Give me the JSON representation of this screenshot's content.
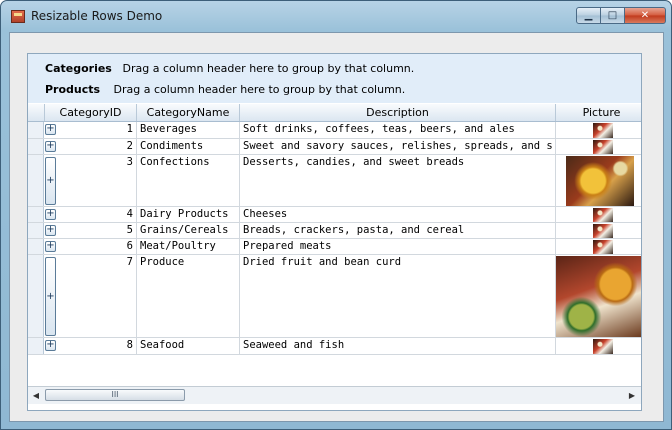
{
  "window": {
    "title": "Resizable Rows Demo",
    "controls": {
      "minimize": "▁",
      "maximize": "□",
      "close": "✕"
    }
  },
  "grid": {
    "group_bands": [
      {
        "band": "Categories",
        "hint": "Drag a column header here to group by that column."
      },
      {
        "band": "Products",
        "hint": "Drag a column header here to group by that column."
      }
    ],
    "columns": [
      "CategoryID",
      "CategoryName",
      "Description",
      "Picture"
    ],
    "rows": [
      {
        "id": "1",
        "name": "Beverages",
        "description": "Soft drinks, coffees, teas, beers, and ales",
        "picture": "small"
      },
      {
        "id": "2",
        "name": "Condiments",
        "description": "Sweet and savory sauces, relishes, spreads, and seasoning",
        "picture": "small"
      },
      {
        "id": "3",
        "name": "Confections",
        "description": "Desserts, candies, and sweet breads",
        "picture": "food1"
      },
      {
        "id": "4",
        "name": "Dairy Products",
        "description": "Cheeses",
        "picture": "small"
      },
      {
        "id": "5",
        "name": "Grains/Cereals",
        "description": "Breads, crackers, pasta, and cereal",
        "picture": "small"
      },
      {
        "id": "6",
        "name": "Meat/Poultry",
        "description": "Prepared meats",
        "picture": "small"
      },
      {
        "id": "7",
        "name": "Produce",
        "description": "Dried fruit and bean curd",
        "picture": "food2"
      },
      {
        "id": "8",
        "name": "Seafood",
        "description": "Seaweed and fish",
        "picture": "small"
      }
    ],
    "expand_glyph": "+",
    "scrollbar": {
      "left_arrow": "◀",
      "right_arrow": "▶",
      "thumb_grip": "III"
    }
  }
}
